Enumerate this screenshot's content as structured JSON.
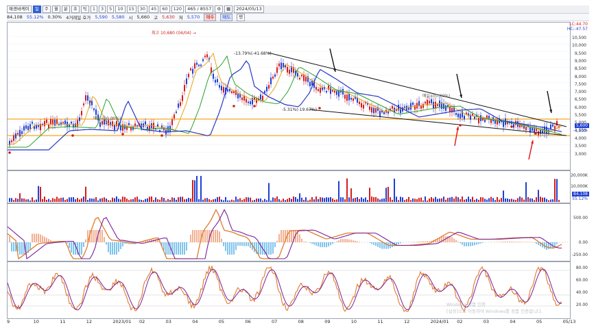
{
  "toolbar": {
    "stock_name": "매경바케이",
    "timeframes": [
      "일",
      "주",
      "월",
      "분",
      "초",
      "틱"
    ],
    "selected": "일",
    "intervals": [
      "1",
      "3",
      "5",
      "10",
      "15",
      "30",
      "45",
      "60",
      "120"
    ],
    "range_value": "465 / 8557",
    "date": "2024/05/13"
  },
  "info": {
    "volume": "84,108",
    "ratio": "55.12%",
    "change": "0.30%",
    "quote_label": "4거래일 호가",
    "bid": "5,590",
    "ask": "5,580",
    "open_label": "시",
    "open": "5,660",
    "high_label": "고",
    "high": "5,630",
    "low_label": "저",
    "low": "5,570",
    "buy_label": "매수",
    "sell_label": "매도",
    "flat_label": "평"
  },
  "price_panel": {
    "high_annotation": "최고 10,680 (04/04) →",
    "top_line_label": "-13.79%(-41.68%)",
    "bottom_line_label": "-5.31%(-19.67%)",
    "mid_label": "매일시(0.00%)",
    "left_label": "매일시(0.00%)",
    "lc_label": "LC:44.70",
    "hc_label": "HC:-47.57",
    "ticks": [
      "10,500",
      "10,000",
      "9,500",
      "9,000",
      "8,500",
      "8,000",
      "7,500",
      "7,000",
      "6,500",
      "6,000",
      "5,500",
      "5,000",
      "4,500",
      "4,000",
      "3,500",
      "3,000"
    ],
    "last_price_tag": "5,600",
    "last_pct_tag": "-1.05%"
  },
  "volume_panel": {
    "ticks": [
      "20,000K",
      "10,000K"
    ],
    "last_tag": "84,108",
    "last_pct": "55.12%"
  },
  "macd_panel": {
    "ticks": [
      "500.00",
      "0.00",
      "-250.00"
    ]
  },
  "stoch_panel": {
    "ticks": [
      "80.00",
      "60.00",
      "40.00",
      "20.00"
    ]
  },
  "x_axis": [
    "9",
    "10",
    "11",
    "12",
    "2023/01",
    "02",
    "03",
    "04",
    "05",
    "06",
    "07",
    "08",
    "09",
    "10",
    "11",
    "12",
    "2024/01",
    "02",
    "03",
    "04",
    "05",
    "05/13"
  ],
  "watermark": {
    "line1": "Windows 정품 인증",
    "line2": "[설정]으로 이동하여 Windows를 정품 인증합니다."
  },
  "colors": {
    "up": "#d21c1c",
    "down": "#1f3fd1",
    "ma_short": "#e8a21a",
    "ma_mid": "#2aa12a",
    "ma_long": "#2535c8",
    "macd": "#e07a2a",
    "signal": "#7a1f9a",
    "support": "#f5a623"
  }
}
